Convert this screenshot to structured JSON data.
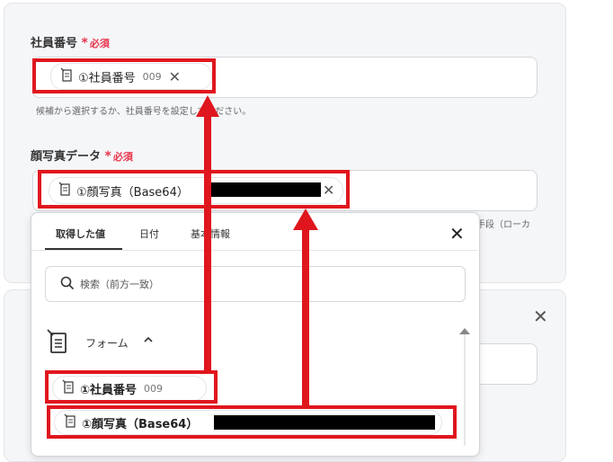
{
  "field1": {
    "label": "社員番号",
    "required_mark": "*",
    "required_text": "必須",
    "chip_text": "①社員番号",
    "chip_num": "009",
    "hint": "候補から選択するか、社員番号を設定してください。"
  },
  "field2": {
    "label": "顔写真データ",
    "required_mark": "*",
    "required_text": "必須",
    "chip_text": "①顔写真（Base64）",
    "side_hint": "手段（ローカ"
  },
  "panel": {
    "tabs": [
      {
        "label": "取得した値"
      },
      {
        "label": "日付"
      },
      {
        "label": "基本情報"
      }
    ],
    "search_placeholder": "検索（前方一致）",
    "group_label": "フォーム",
    "items": [
      {
        "text": "①社員番号",
        "num": "009"
      },
      {
        "text": "①顔写真（Base64）"
      }
    ]
  },
  "colors": {
    "annotation_red": "#e0161e",
    "required_red": "#e8334a"
  }
}
